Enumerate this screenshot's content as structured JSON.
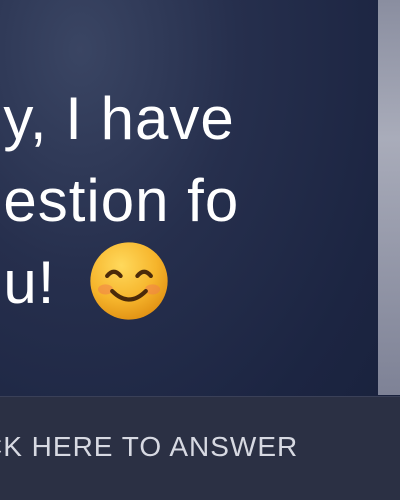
{
  "message": {
    "line1": "ey, I have",
    "line2": "uestion fo",
    "line3": "ou!",
    "emoji": "smiling-face-icon"
  },
  "cta": {
    "label": "CK HERE TO ANSWER"
  },
  "colors": {
    "background": "#1f2a44",
    "text": "#ffffff",
    "cta_background": "#2b3044",
    "cta_text": "#d7d9e2",
    "emoji_face": "#f6b52c"
  }
}
